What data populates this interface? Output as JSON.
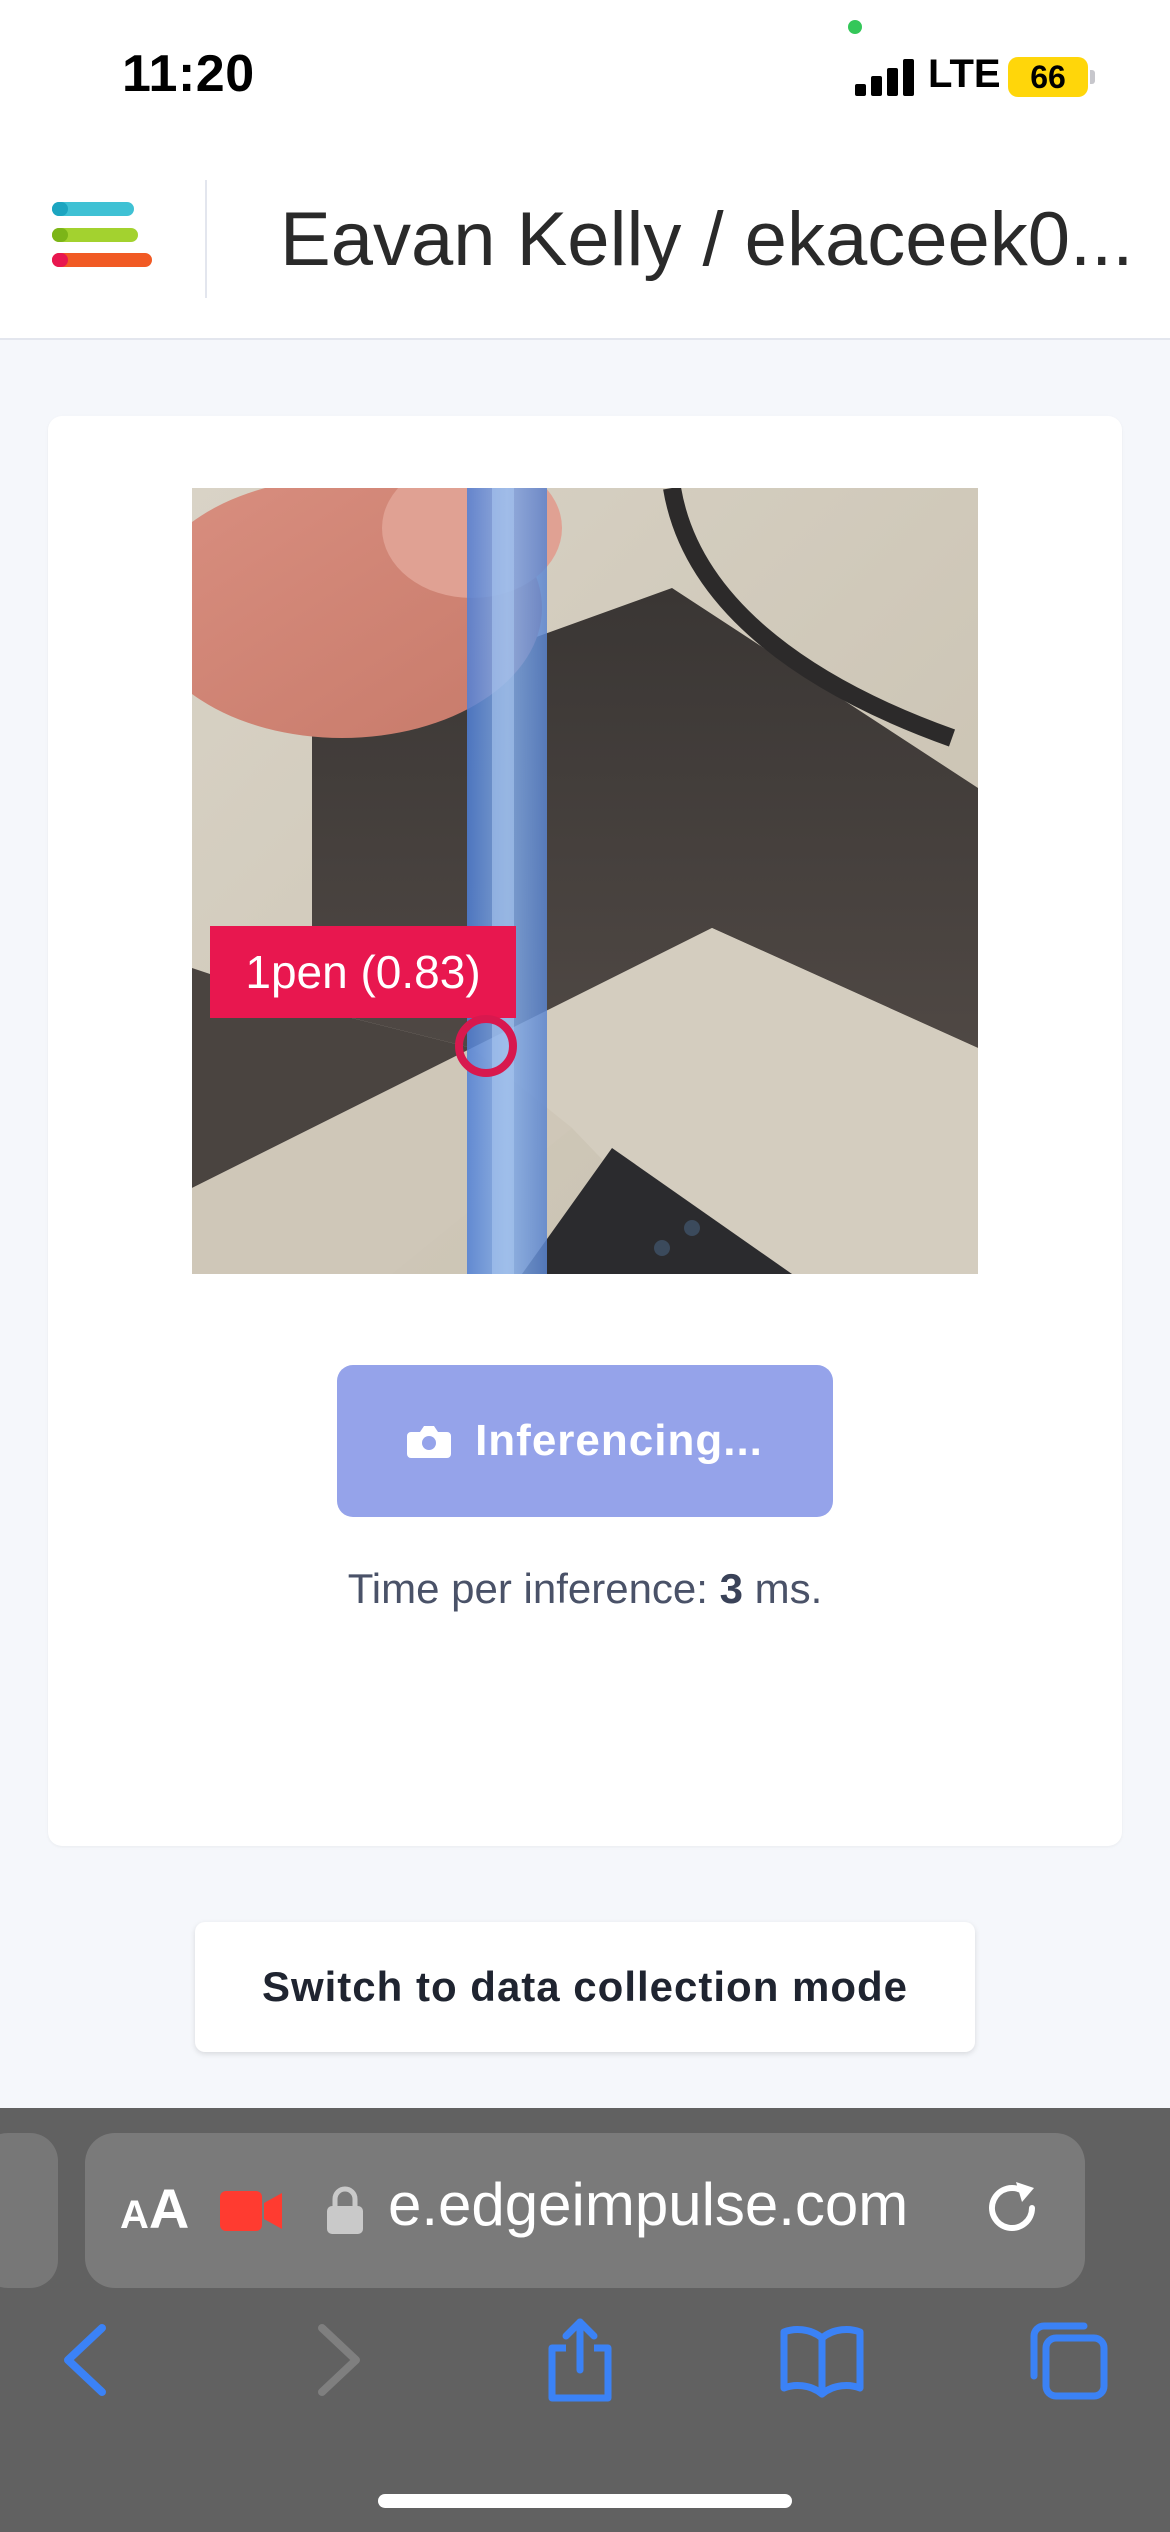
{
  "status_bar": {
    "time": "11:20",
    "network": "LTE",
    "battery": "66"
  },
  "header": {
    "title": "Eavan Kelly / ekaceek0..."
  },
  "detection": {
    "label": "1pen (0.83)",
    "confidence": 0.83
  },
  "inference": {
    "button_label": "Inferencing...",
    "time_prefix": "Time per inference: ",
    "time_value": "3",
    "time_suffix": " ms."
  },
  "switch_mode_label": "Switch to data collection mode",
  "browser": {
    "text_size_small": "A",
    "text_size_large": "A",
    "url": "e.edgeimpulse.com"
  },
  "colors": {
    "accent_button": "#95a3ea",
    "detection_label": "#e8174f",
    "browser_blue": "#3b82f6"
  }
}
